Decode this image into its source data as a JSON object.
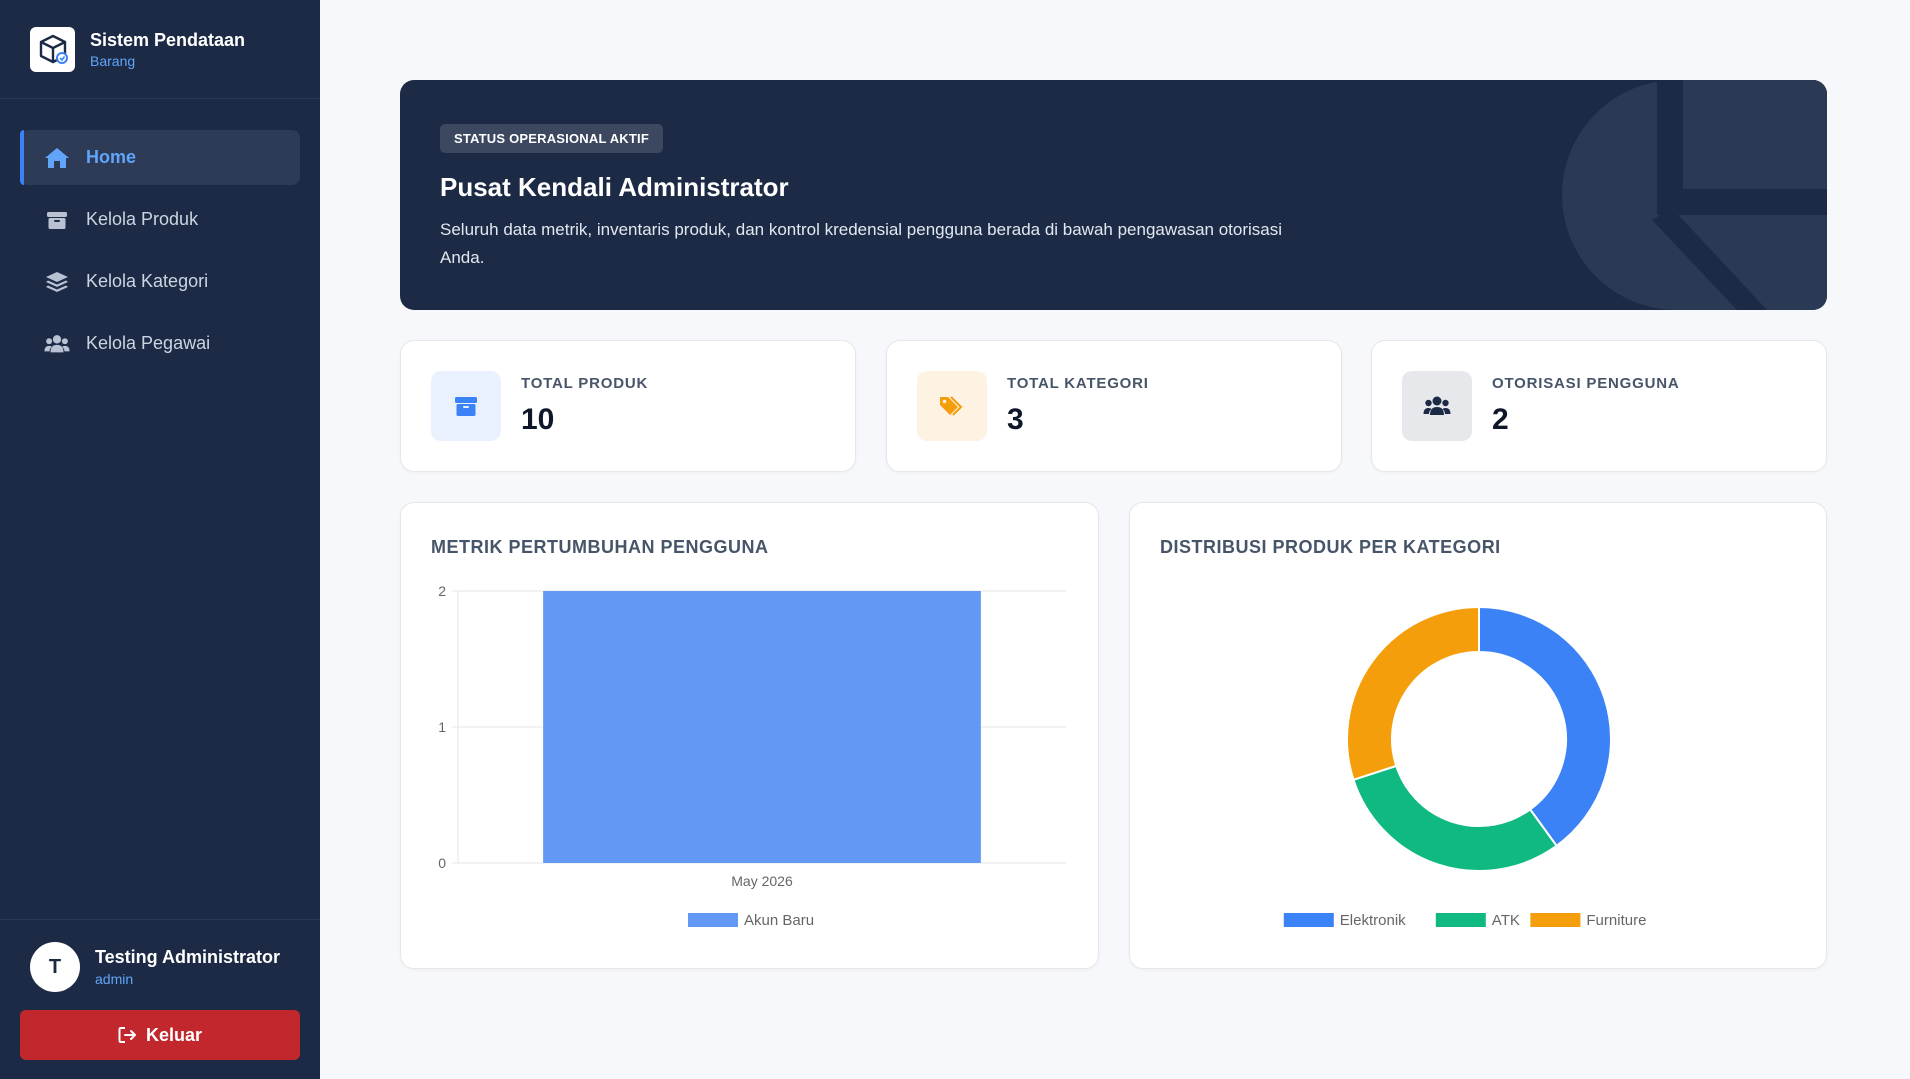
{
  "brand": {
    "title": "Sistem Pendataan",
    "subtitle": "Barang",
    "logo_icon": "box-icon"
  },
  "sidebar": {
    "items": [
      {
        "label": "Home",
        "icon": "home-icon",
        "active": true
      },
      {
        "label": "Kelola Produk",
        "icon": "box-icon",
        "active": false
      },
      {
        "label": "Kelola Kategori",
        "icon": "layers-icon",
        "active": false
      },
      {
        "label": "Kelola Pegawai",
        "icon": "users-icon",
        "active": false
      }
    ]
  },
  "user": {
    "initial": "T",
    "name": "Testing Administrator",
    "role": "admin",
    "logout_label": "Keluar"
  },
  "hero": {
    "badge": "STATUS OPERASIONAL AKTIF",
    "title": "Pusat Kendali Administrator",
    "description": "Seluruh data metrik, inventaris produk, dan kontrol kredensial pengguna berada di bawah pengawasan otorisasi Anda."
  },
  "stats": [
    {
      "label": "TOTAL PRODUK",
      "value": "10",
      "icon": "box-icon",
      "color": "#3b82f6"
    },
    {
      "label": "TOTAL KATEGORI",
      "value": "3",
      "icon": "tags-icon",
      "color": "#f59e0b"
    },
    {
      "label": "OTORISASI PENGGUNA",
      "value": "2",
      "icon": "users-icon",
      "color": "#1c2a45"
    }
  ],
  "charts": {
    "growth_title": "METRIK PERTUMBUHAN PENGGUNA",
    "distribution_title": "DISTRIBUSI PRODUK PER KATEGORI"
  },
  "colors": {
    "sidebar": "#1c2a45",
    "accent": "#3b82f6",
    "danger": "#c1272d"
  },
  "chart_data": [
    {
      "type": "bar",
      "title": "METRIK PERTUMBUHAN PENGGUNA",
      "categories": [
        "May 2026"
      ],
      "series": [
        {
          "name": "Akun Baru",
          "values": [
            2
          ],
          "color": "#6299f5"
        }
      ],
      "ylim": [
        0,
        2
      ],
      "yticks": [
        "0",
        "1",
        "2"
      ],
      "grid": true,
      "legend": "bottom"
    },
    {
      "type": "pie",
      "title": "DISTRIBUSI PRODUK PER KATEGORI",
      "categories": [
        "Elektronik",
        "ATK",
        "Furniture"
      ],
      "values": [
        4,
        3,
        3
      ],
      "colors": [
        "#3b82f6",
        "#10b981",
        "#f59e0b"
      ],
      "legend": "bottom"
    }
  ]
}
